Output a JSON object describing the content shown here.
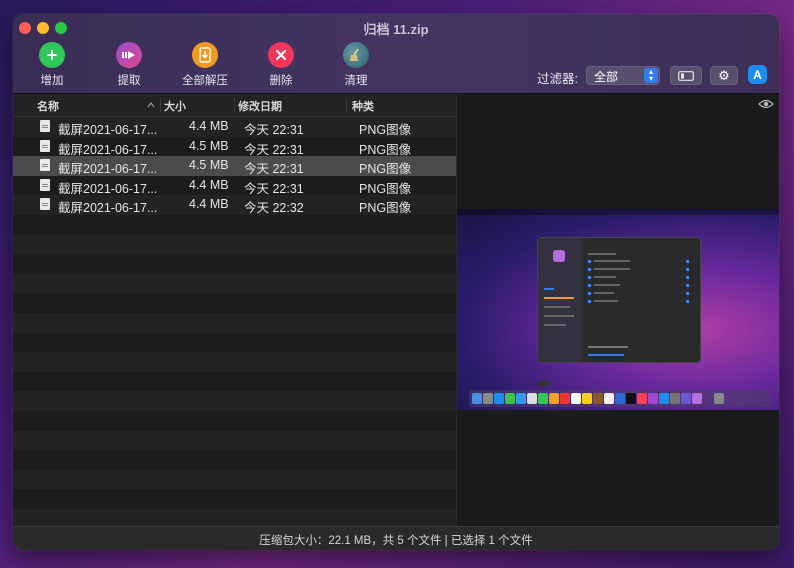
{
  "window": {
    "title": "归档 11.zip"
  },
  "toolbar": {
    "add_label": "增加",
    "extract_label": "提取",
    "extract_all_label": "全部解压",
    "delete_label": "删除",
    "clean_label": "清理",
    "filter_label": "过滤器:",
    "filter_value": "全部"
  },
  "table": {
    "headers": {
      "name": "名称",
      "size": "大小",
      "modified": "修改日期",
      "kind": "种类"
    },
    "rows": [
      {
        "name": "截屏2021-06-17...",
        "size": "4.4 MB",
        "modified": "今天 22:31",
        "kind": "PNG图像"
      },
      {
        "name": "截屏2021-06-17...",
        "size": "4.5 MB",
        "modified": "今天 22:31",
        "kind": "PNG图像"
      },
      {
        "name": "截屏2021-06-17...",
        "size": "4.5 MB",
        "modified": "今天 22:31",
        "kind": "PNG图像"
      },
      {
        "name": "截屏2021-06-17...",
        "size": "4.4 MB",
        "modified": "今天 22:31",
        "kind": "PNG图像"
      },
      {
        "name": "截屏2021-06-17...",
        "size": "4.4 MB",
        "modified": "今天 22:32",
        "kind": "PNG图像"
      }
    ],
    "selected_index": 2
  },
  "status": {
    "text": "压缩包大小：22.1 MB，共 5 个文件 | 已选择 1 个文件"
  },
  "colors": {
    "add": "#2fc75a",
    "extract": "#c74ab0",
    "extract_all": "#f29a1e",
    "delete": "#f0365a",
    "clean": "#3c7a8a",
    "accent": "#2f7cf6"
  }
}
